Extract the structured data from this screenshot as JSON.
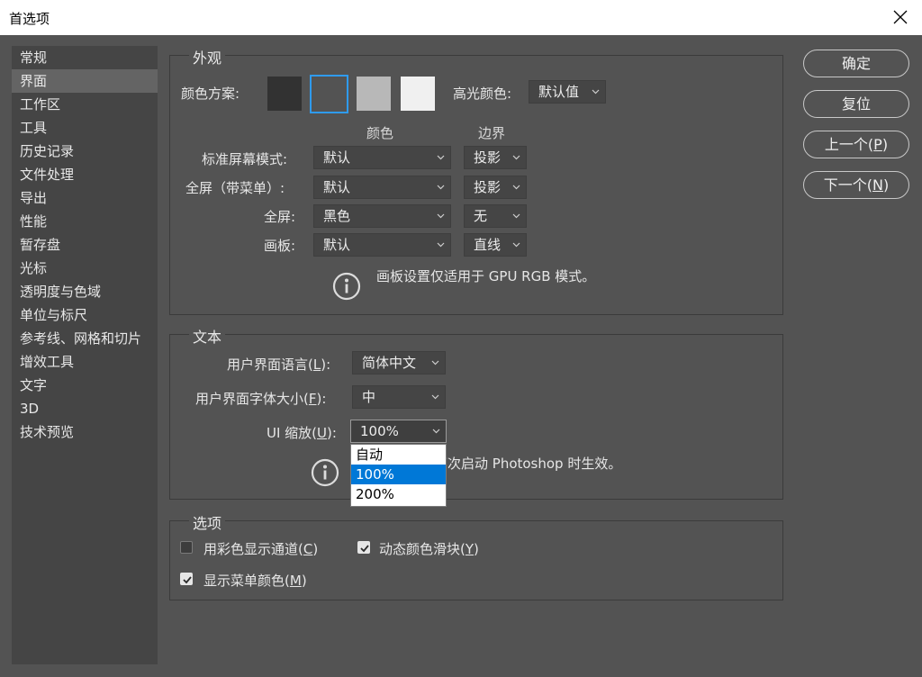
{
  "window": {
    "title": "首选项"
  },
  "sidebar": {
    "items": [
      {
        "label": "常规"
      },
      {
        "label": "界面",
        "active": true
      },
      {
        "label": "工作区"
      },
      {
        "label": "工具"
      },
      {
        "label": "历史记录"
      },
      {
        "label": "文件处理"
      },
      {
        "label": "导出"
      },
      {
        "label": "性能"
      },
      {
        "label": "暂存盘"
      },
      {
        "label": "光标"
      },
      {
        "label": "透明度与色域"
      },
      {
        "label": "单位与标尺"
      },
      {
        "label": "参考线、网格和切片"
      },
      {
        "label": "增效工具"
      },
      {
        "label": "文字"
      },
      {
        "label": "3D"
      },
      {
        "label": "技术预览"
      }
    ]
  },
  "appearance": {
    "group_label": "外观",
    "color_scheme_label": "颜色方案:",
    "swatches": [
      "#323232",
      "#535353",
      "#b8b8b8",
      "#f0f0f0"
    ],
    "selected_swatch_index": 1,
    "highlight_color_label": "高光颜色:",
    "highlight_color_value": "默认值",
    "col_color": "颜色",
    "col_border": "边界",
    "rows": [
      {
        "label": "标准屏幕模式:",
        "color": "默认",
        "border": "投影"
      },
      {
        "label": "全屏（带菜单）:",
        "color": "默认",
        "border": "投影"
      },
      {
        "label": "全屏:",
        "color": "黑色",
        "border": "无"
      },
      {
        "label": "画板:",
        "color": "默认",
        "border": "直线"
      }
    ],
    "info": "画板设置仅适用于 GPU RGB 模式。"
  },
  "text": {
    "group_label": "文本",
    "ui_language_label": "用户界面语言(",
    "ui_language_key": "L",
    "ui_language_value": "简体中文",
    "ui_font_size_label": "用户界面字体大小(",
    "ui_font_size_key": "F",
    "ui_font_size_value": "中",
    "ui_scale_label": "UI 缩放(",
    "ui_scale_key": "U",
    "ui_scale_value": "100%",
    "ui_scale_options": [
      "自动",
      "100%",
      "200%"
    ],
    "ui_scale_highlight_index": 1,
    "info": "下次启动 Photoshop 时生效。"
  },
  "options": {
    "group_label": "选项",
    "checkboxes": [
      {
        "label": "用彩色显示通道(",
        "key": "C",
        "checked": false
      },
      {
        "label": "动态颜色滑块(",
        "key": "Y",
        "checked": true
      },
      {
        "label": "显示菜单颜色(",
        "key": "M",
        "checked": true
      }
    ]
  },
  "buttons": {
    "ok": "确定",
    "reset": "复位",
    "prev_label": "上一个(",
    "prev_key": "P",
    "next_label": "下一个(",
    "next_key": "N"
  },
  "icons": {
    "close": "close-icon",
    "chevron": "chevron-down-icon",
    "info": "info-icon",
    "check": "checkmark-icon"
  }
}
